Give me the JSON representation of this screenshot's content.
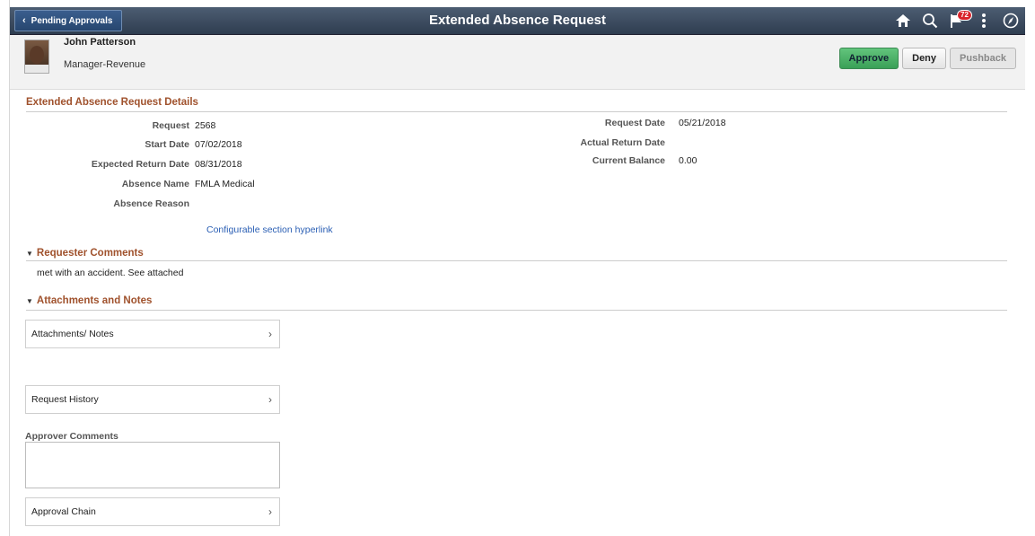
{
  "topbar": {
    "back_label": "Pending Approvals",
    "title": "Extended Absence Request",
    "notification_count": "72"
  },
  "employee": {
    "name": "John Patterson",
    "job_title": "Manager-Revenue"
  },
  "actions": {
    "approve": "Approve",
    "deny": "Deny",
    "pushback": "Pushback"
  },
  "details": {
    "heading": "Extended Absence Request Details",
    "request_label": "Request",
    "request_value": "2568",
    "start_date_label": "Start Date",
    "start_date_value": "07/02/2018",
    "expected_return_label": "Expected Return Date",
    "expected_return_value": "08/31/2018",
    "absence_name_label": "Absence Name",
    "absence_name_value": "FMLA Medical",
    "absence_reason_label": "Absence Reason",
    "request_date_label": "Request Date",
    "request_date_value": "05/21/2018",
    "actual_return_label": "Actual Return Date",
    "current_balance_label": "Current Balance",
    "current_balance_value": "0.00",
    "hyperlink": "Configurable section hyperlink"
  },
  "requester_comments": {
    "heading": "Requester Comments",
    "text": "met with an accident. See attached"
  },
  "attachments": {
    "heading": "Attachments and Notes",
    "attachments_row": "Attachments/ Notes",
    "history_row": "Request History",
    "approver_comments_label": "Approver Comments",
    "approval_chain_row": "Approval Chain"
  },
  "colors": {
    "accent_heading": "#a0522d",
    "topbar": "#3b4a5e",
    "approve": "#4cb36a",
    "link": "#2b5fb4"
  }
}
